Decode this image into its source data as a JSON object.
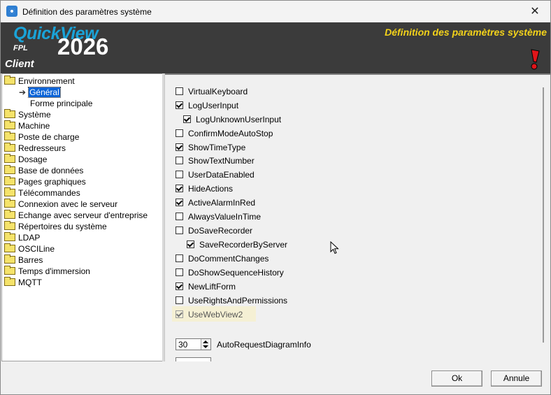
{
  "window": {
    "title": "Définition des paramètres système",
    "close_glyph": "✕"
  },
  "banner": {
    "brand_name": "QuickView",
    "brand_fpl": "FPL",
    "brand_year": "2026",
    "brand_client": "Client",
    "page_title": "Définition des paramètres système",
    "alert_icon": "exclamation-alert-icon"
  },
  "tree": {
    "items": [
      {
        "label": "Environnement",
        "icon": "folder-icon"
      },
      {
        "label": "Général",
        "icon": "arrow-right-icon",
        "selected": true
      },
      {
        "label": "Forme principale"
      },
      {
        "label": "Système",
        "icon": "folder-icon"
      },
      {
        "label": "Machine",
        "icon": "folder-icon"
      },
      {
        "label": "Poste de charge",
        "icon": "folder-icon"
      },
      {
        "label": "Redresseurs",
        "icon": "folder-icon"
      },
      {
        "label": "Dosage",
        "icon": "folder-icon"
      },
      {
        "label": "Base de données",
        "icon": "folder-icon"
      },
      {
        "label": "Pages graphiques",
        "icon": "folder-icon"
      },
      {
        "label": "Télécommandes",
        "icon": "folder-icon"
      },
      {
        "label": "Connexion avec le serveur",
        "icon": "folder-icon"
      },
      {
        "label": "Echange avec serveur d'entreprise",
        "icon": "folder-icon"
      },
      {
        "label": "Répertoires du système",
        "icon": "folder-icon"
      },
      {
        "label": "LDAP",
        "icon": "folder-icon"
      },
      {
        "label": "OSCILine",
        "icon": "folder-icon"
      },
      {
        "label": "Barres",
        "icon": "folder-icon"
      },
      {
        "label": "Temps d'immersion",
        "icon": "folder-icon"
      },
      {
        "label": "MQTT",
        "icon": "folder-icon"
      }
    ]
  },
  "options": [
    {
      "label": "VirtualKeyboard",
      "checked": false
    },
    {
      "label": "LogUserInput",
      "checked": true
    },
    {
      "label": "LogUnknownUserInput",
      "checked": true
    },
    {
      "label": "ConfirmModeAutoStop",
      "checked": false
    },
    {
      "label": "ShowTimeType",
      "checked": true
    },
    {
      "label": "ShowTextNumber",
      "checked": false
    },
    {
      "label": "UserDataEnabled",
      "checked": false
    },
    {
      "label": "HideActions",
      "checked": true
    },
    {
      "label": "ActiveAlarmInRed",
      "checked": true
    },
    {
      "label": "AlwaysValueInTime",
      "checked": false
    },
    {
      "label": "DoSaveRecorder",
      "checked": false
    },
    {
      "label": "SaveRecorderByServer",
      "checked": true
    },
    {
      "label": "DoCommentChanges",
      "checked": false
    },
    {
      "label": "DoShowSequenceHistory",
      "checked": false
    },
    {
      "label": "NewLiftForm",
      "checked": true
    },
    {
      "label": "UseRightsAndPermissions",
      "checked": false
    },
    {
      "label": "UseWebView2",
      "checked": true,
      "disabled": true
    }
  ],
  "auto_request": {
    "value": "30",
    "label": "AutoRequestDiagramInfo"
  },
  "footer": {
    "ok_label": "Ok",
    "cancel_label": "Annule"
  },
  "colors": {
    "banner_bg": "#3b3b3b",
    "brand_blue": "#1aa3d8",
    "title_yellow": "#f3d21a",
    "selection_blue": "#0a64d8"
  }
}
